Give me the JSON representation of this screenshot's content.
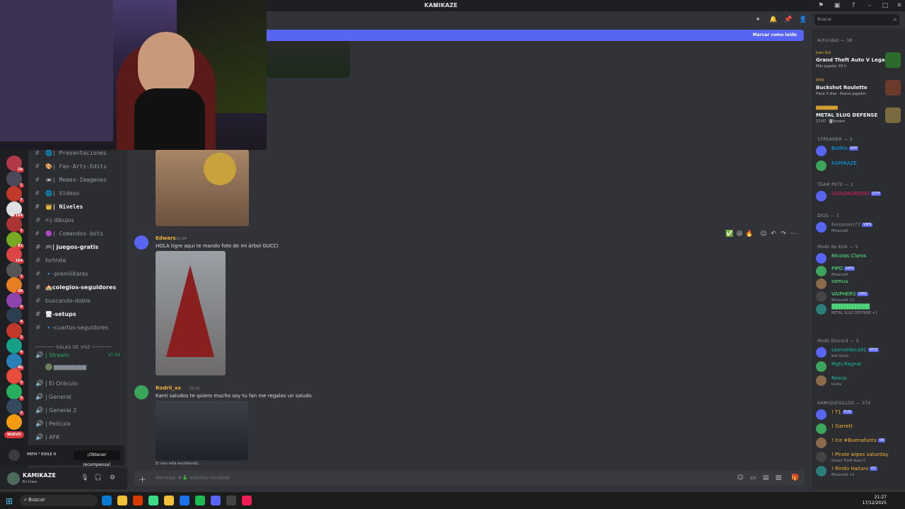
{
  "window": {
    "title": "KAMIKAZE"
  },
  "servers": {
    "badges": [
      "26",
      "1",
      "7",
      "164",
      "1",
      "83",
      "164",
      "1",
      "48",
      "4",
      "4",
      "2",
      "4",
      "40",
      "3",
      "3",
      "2",
      "1"
    ],
    "nuevo": "NUEVO"
  },
  "channels": [
    {
      "name": "| Presentaciones",
      "style": "mono",
      "prefix": "🌐"
    },
    {
      "name": "| Fan-Arts-Edits",
      "style": "mono",
      "prefix": "🎨"
    },
    {
      "name": "| Memes-Imagenes",
      "style": "mono",
      "prefix": "📼"
    },
    {
      "name": "| Videos",
      "style": "mono",
      "prefix": "🌐"
    },
    {
      "name": "| Niveles",
      "style": "bold mono",
      "prefix": "👑"
    },
    {
      "name": "| dibujos",
      "style": "",
      "prefix": "✍"
    },
    {
      "name": "| Comandos-bots",
      "style": "mono",
      "prefix": "🟣"
    },
    {
      "name": "| juegos-gratis",
      "style": "bold",
      "prefix": "🎮"
    },
    {
      "name": "fortnite",
      "style": "",
      "prefix": ""
    },
    {
      "name": "-premilitares",
      "style": "",
      "prefix": "🔹"
    },
    {
      "name": "colegios-seguidores",
      "style": "bold",
      "prefix": "🏫"
    },
    {
      "name": "buscando-doble",
      "style": "",
      "prefix": ""
    },
    {
      "name": "-setups",
      "style": "bold",
      "prefix": "🖥"
    },
    {
      "name": "-cuartos-seguidores",
      "style": "",
      "prefix": "🔹"
    }
  ],
  "voice": {
    "header": "SALAS DE VOZ",
    "stream": {
      "name": "| Stream",
      "time": "47:34",
      "user": "▓▓▓▓▓▓▓▓▓▓"
    },
    "rooms": [
      "| El Oráculo",
      "| General",
      "| General 2",
      "| Película",
      "| AFK"
    ]
  },
  "promo": {
    "text": "PATH ᴬ EXILE II",
    "button": "¡Obtener recompensa!"
  },
  "user": {
    "name": "KAMIKAZE",
    "status": "En línea"
  },
  "unread": {
    "label": "Marcar como leído"
  },
  "messages": [
    {
      "author": "Edwars",
      "time": "21:14",
      "text": "HOLA tigre aqui te mando foto de mi árbol GUCCI"
    },
    {
      "author": "Rodrii_xx",
      "time": "21:15",
      "text": "Kami saludos te quiero mucho soy tu fan me regalas un saludo"
    }
  ],
  "typing": "El max está escribiendo...",
  "composer": {
    "placeholder": "Mensaje #🎄-arboles-navidad"
  },
  "search": {
    "placeholder": "Buscar"
  },
  "members": {
    "activity_header": "Actividad — 38",
    "activities": [
      {
        "user": "Juan Scz",
        "game": "Grand Theft Auto V Legacy",
        "meta": "Más jugado: 93 h"
      },
      {
        "user": "PIPO",
        "game": "Buckshot Roulette",
        "meta": "Hace 3 días · Nuevo jugador"
      },
      {
        "user": "▓▓▓▓▓▓▓▓",
        "game": "METAL SLUG DEFENSE",
        "meta": "27:07 · ▓Stream"
      }
    ],
    "sections": [
      {
        "title": "STREAMER — 2",
        "items": [
          {
            "name": "BotRix",
            "tag": "APP",
            "sub": "",
            "color": "#00a8fc"
          },
          {
            "name": "KAMIKAZE",
            "tag": "",
            "sub": "",
            "color": "#00a8fc"
          }
        ]
      },
      {
        "title": "TEAM PETE — 1",
        "items": [
          {
            "name": "LEOLOKARDOO",
            "tag": "QTH",
            "sub": "",
            "color": "#e91e63"
          }
        ]
      },
      {
        "title": "DIOS — 1",
        "items": [
          {
            "name": "Fenomen77",
            "tag": "VIPS",
            "sub": "Minecraft",
            "color": "#80848e"
          }
        ]
      },
      {
        "title": "Mods de Kick — 5",
        "items": [
          {
            "name": "Nicolas Claros",
            "tag": "",
            "sub": "",
            "color": "#57f287"
          },
          {
            "name": "PIPO",
            "tag": "VIPS",
            "sub": "Minecraft",
            "color": "#57f287"
          },
          {
            "name": "samuu",
            "tag": "",
            "sub": "",
            "color": "#57f287"
          },
          {
            "name": "VAIPHERS",
            "tag": "VIPS",
            "sub": "Minecraft +1",
            "color": "#57f287"
          },
          {
            "name": "▓▓▓▓▓▓▓▓▓▓",
            "tag": "",
            "sub": "METAL SLUG DEFENSE +1",
            "color": "#57f287"
          }
        ]
      },
      {
        "title": "Mods Discord — 3",
        "items": [
          {
            "name": "Leonardoca91",
            "tag": "KICK",
            "sub": "Kali Uchis",
            "color": "#1abc9c"
          },
          {
            "name": "Mgtr.Ragnar",
            "tag": "",
            "sub": "",
            "color": "#1abc9c"
          },
          {
            "name": "Nexus",
            "tag": "",
            "sub": "Invita",
            "color": "#1abc9c"
          }
        ]
      },
      {
        "title": "KAMIQUESILLOS — 574",
        "items": [
          {
            "name": "! T1",
            "tag": "FCB",
            "sub": "",
            "color": "#f0b232"
          },
          {
            "name": "! Garrett",
            "tag": "",
            "sub": "",
            "color": "#f0b232"
          },
          {
            "name": "! Ice ❄Buenafanta",
            "tag": "09",
            "sub": "",
            "color": "#f0b232"
          },
          {
            "name": "! Pirate wipes saturday",
            "tag": "",
            "sub": "Grand Theft Auto V",
            "color": "#f0b232"
          },
          {
            "name": "! Rindo Haitani",
            "tag": "EZ",
            "sub": "Minecraft +1",
            "color": "#f0b232"
          }
        ]
      }
    ]
  },
  "taskbar": {
    "search": "Buscar",
    "time": "21:27",
    "date": "17/12/2025"
  }
}
